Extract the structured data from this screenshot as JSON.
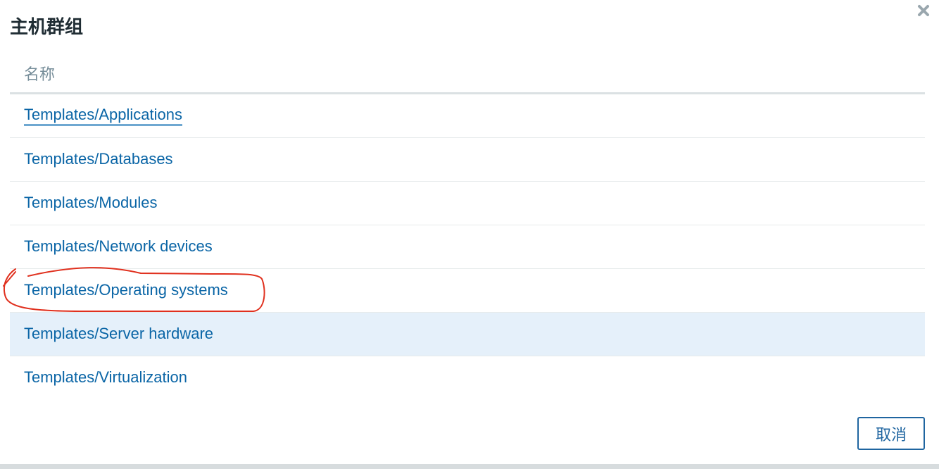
{
  "dialog": {
    "title": "主机群组",
    "close_icon": "close-icon"
  },
  "table": {
    "column_header": "名称",
    "rows": [
      {
        "label": "Templates/Applications"
      },
      {
        "label": "Templates/Databases"
      },
      {
        "label": "Templates/Modules"
      },
      {
        "label": "Templates/Network devices"
      },
      {
        "label": "Templates/Operating systems"
      },
      {
        "label": "Templates/Server hardware"
      },
      {
        "label": "Templates/Virtualization"
      }
    ]
  },
  "footer": {
    "cancel_label": "取消"
  },
  "colors": {
    "link": "#0a65a6",
    "hover_row": "#e5f0fa",
    "annotation": "#e0301e",
    "button_border": "#1f65a0"
  }
}
